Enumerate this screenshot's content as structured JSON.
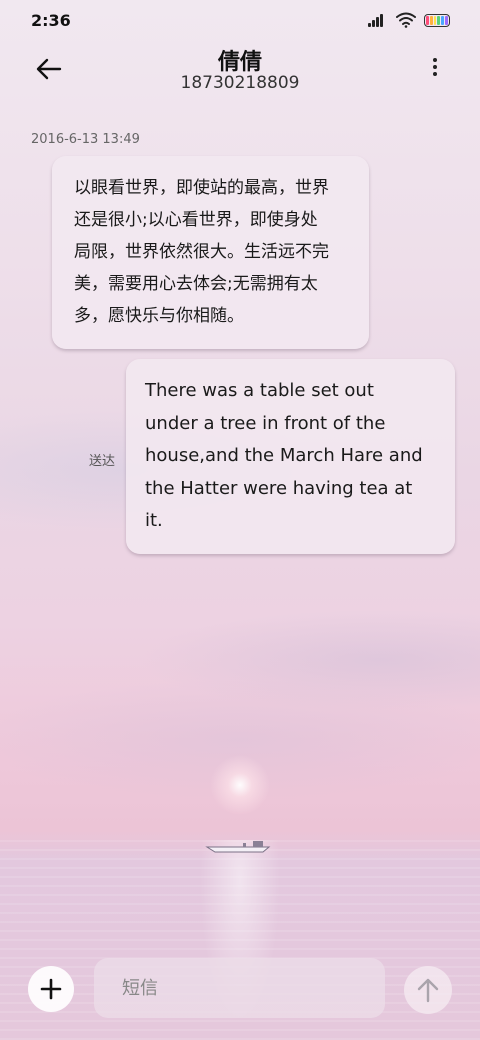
{
  "status_bar": {
    "time": "2:36",
    "icons": [
      "signal-icon",
      "wifi-icon",
      "battery-icon"
    ],
    "battery_colors": [
      "#ff4d7a",
      "#ffb23f",
      "#ffe14a",
      "#5ad17a",
      "#4aa8ff",
      "#9a6bff"
    ]
  },
  "header": {
    "back_icon": "arrow-left-icon",
    "contact_name": "倩倩",
    "contact_number": "18730218809",
    "more_icon": "more-vertical-icon"
  },
  "conversation": {
    "timestamp": "2016-6-13 13:49",
    "messages": [
      {
        "direction": "incoming",
        "lines": [
          "以眼看世界，即使站的最高，世界",
          "还是很小;以心看世界，即使身处",
          "局限，世界依然很大。生活远不完",
          "美，需要用心去体会;无需拥有太",
          "多，愿快乐与你相随。"
        ]
      },
      {
        "direction": "outgoing",
        "status": "送达",
        "lines": [
          "There was a table set out",
          "under a tree in front of the",
          "house,and the March Hare and",
          "the Hatter were having tea at",
          "it."
        ]
      }
    ]
  },
  "composer": {
    "add_icon": "plus-icon",
    "placeholder": "短信",
    "send_icon": "arrow-up-icon"
  }
}
